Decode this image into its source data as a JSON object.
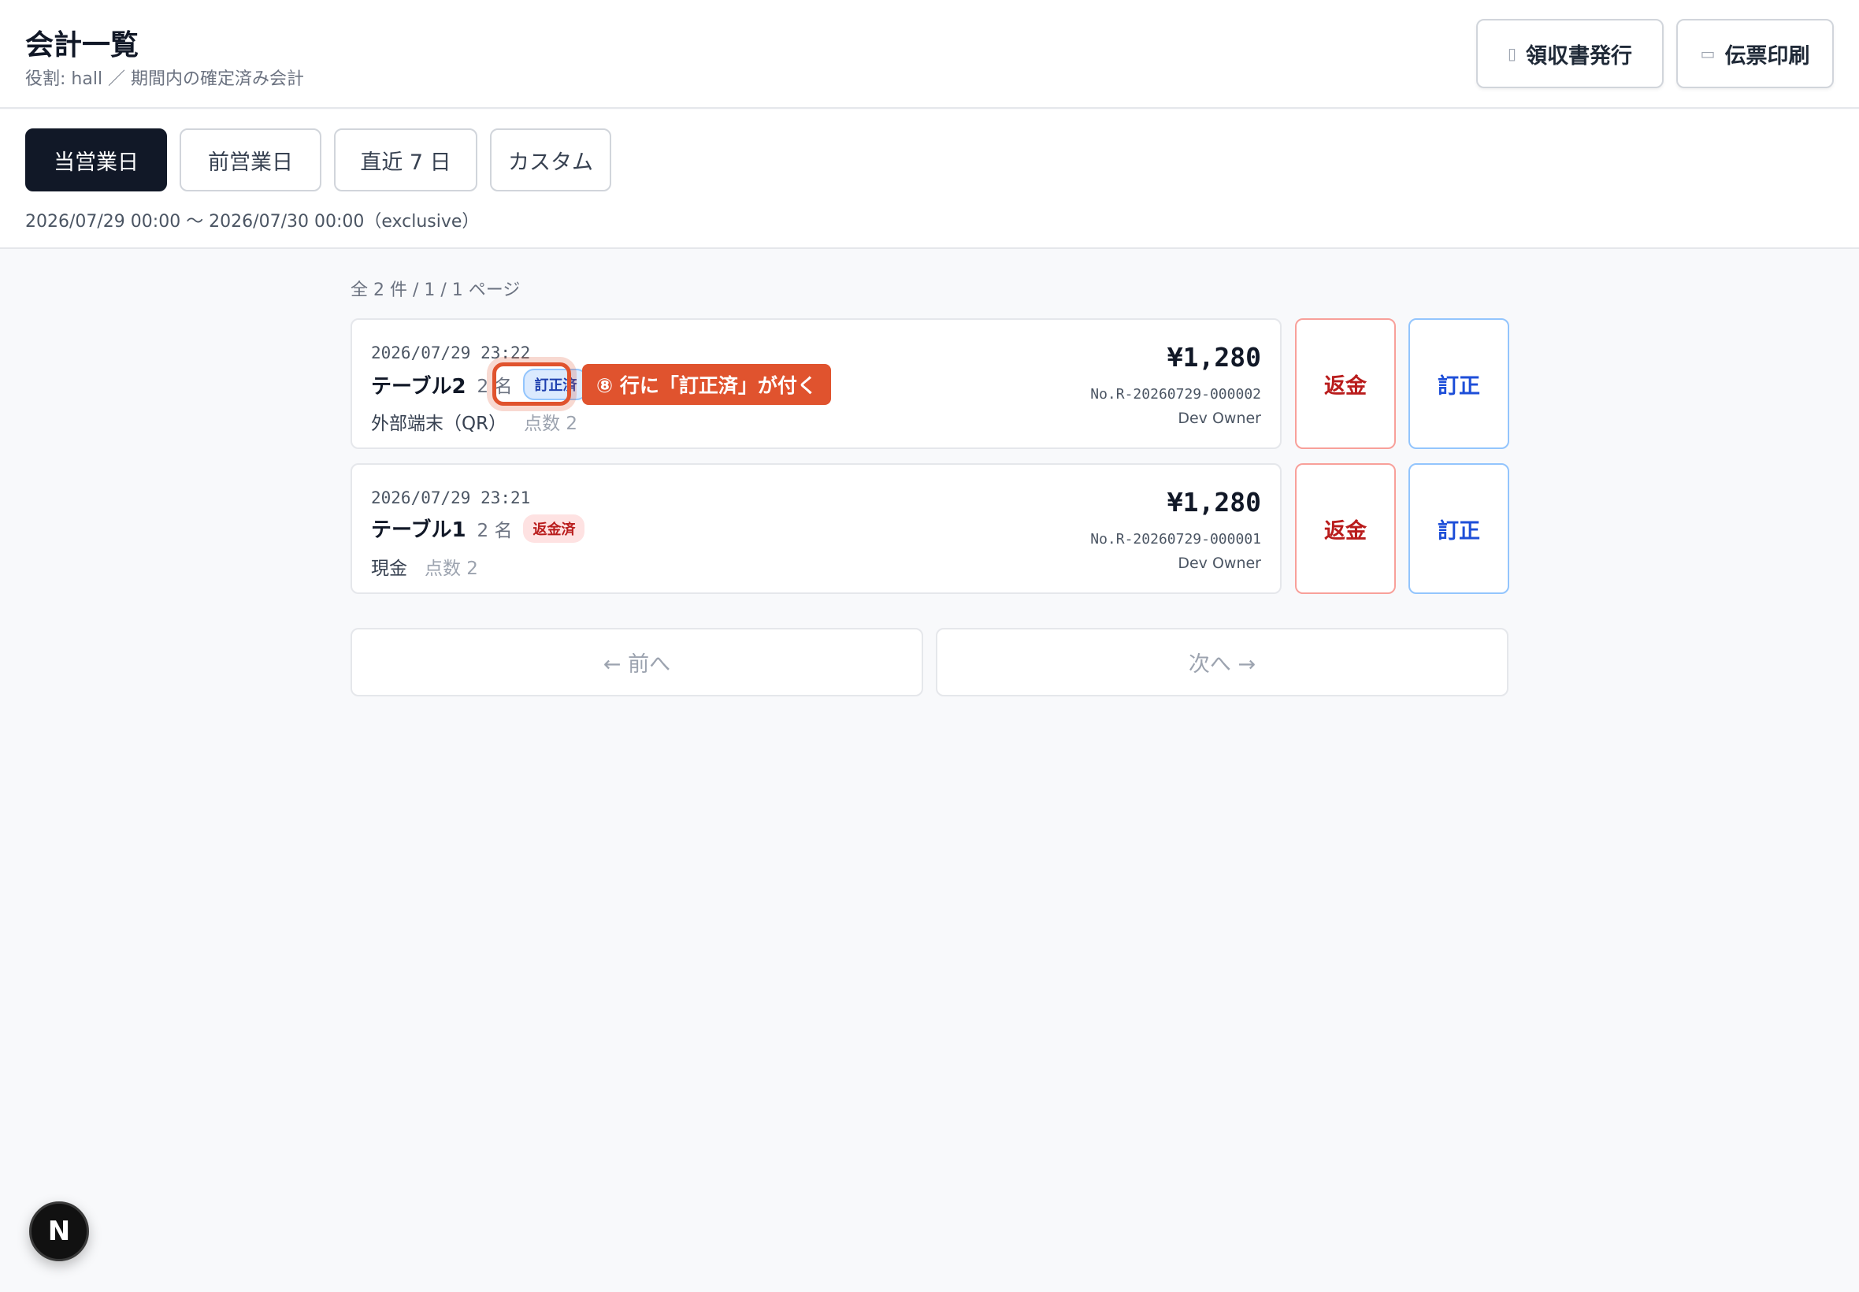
{
  "header": {
    "title": "会計一覧",
    "subtitle": "役割: hall ／ 期間内の確定済み会計",
    "buttons": [
      {
        "label": "領収書発行",
        "icon": "receipt-icon"
      },
      {
        "label": "伝票印刷",
        "icon": "printer-icon"
      }
    ]
  },
  "filters": {
    "tabs": [
      "当営業日",
      "前営業日",
      "直近 7 日",
      "カスタム"
    ],
    "active_tab": "当営業日",
    "range": "2026/07/29 00:00 〜 2026/07/30 00:00（exclusive）"
  },
  "list": {
    "count_text": "全 2 件 / 1 / 1 ページ",
    "rows": [
      {
        "datetime": "2026/07/29 23:22",
        "table": "テーブル2",
        "people": "2 名",
        "badge": "訂正済",
        "payment": "外部端末（QR）",
        "points": "点数 2",
        "amount": "¥1,280",
        "receipt_no": "No.R-20260729-000002",
        "owner": "Dev Owner",
        "refund_label": "返金",
        "correct_label": "訂正"
      },
      {
        "datetime": "2026/07/29 23:21",
        "table": "テーブル1",
        "people": "2 名",
        "badge": "返金済",
        "payment": "現金",
        "points": "点数 2",
        "amount": "¥1,280",
        "receipt_no": "No.R-20260729-000001",
        "owner": "Dev Owner",
        "refund_label": "返金",
        "correct_label": "訂正"
      }
    ]
  },
  "annotation": {
    "callout": "⑧ 行に「訂正済」が付く",
    "color": "#e0532e"
  },
  "pagination": {
    "prev": "← 前へ",
    "next": "次へ →"
  },
  "fab": {
    "label": "N"
  }
}
